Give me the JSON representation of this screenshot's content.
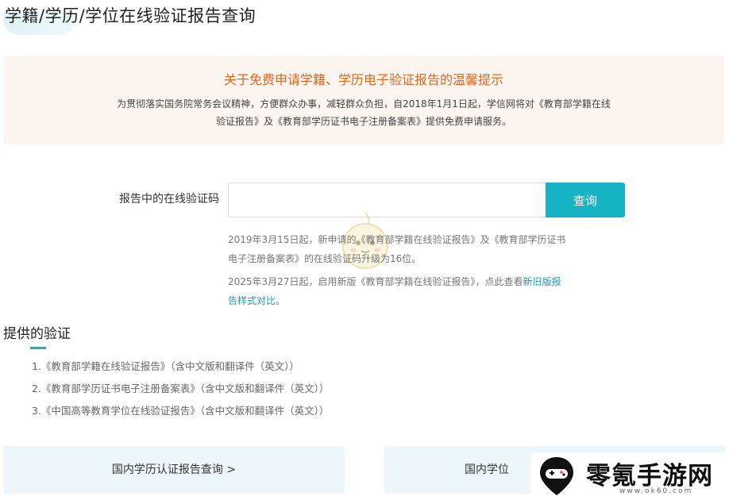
{
  "page": {
    "title": "学籍/学历/学位在线验证报告查询"
  },
  "notice": {
    "title": "关于免费申请学籍、学历电子验证报告的温馨提示",
    "line1": "为贯彻落实国务院常务会议精神，方便群众办事，减轻群众负担，自2018年1月1日起，学信网将对《教育部学籍在线",
    "line2": "验证报告》及《教育部学历证书电子注册备案表》提供免费申请服务。"
  },
  "verify": {
    "label": "报告中的在线验证码",
    "input_value": "",
    "button_label": "查询"
  },
  "hints": {
    "hint1_line1": "2019年3月15日起，新申请的《教育部学籍在线验证报告》及《教育部学历证书",
    "hint1_line2": "电子注册备案表》的在线验证码升级为16位。",
    "hint2_prefix": "2025年3月27日起，启用新版《教育部学籍在线验证报告》，点此查看",
    "hint2_link_line1": "新旧版报",
    "hint2_link_line2": "告样式对比",
    "hint2_suffix": "。"
  },
  "provided": {
    "title": "提供的验证",
    "items": [
      "1.《教育部学籍在线验证报告》（含中文版和翻译件（英文））",
      "2.《教育部学历证书电子注册备案表》（含中文版和翻译件（英文））",
      "3.《中国高等教育学位在线验证报告》（含中文版和翻译件（英文））"
    ]
  },
  "cards": {
    "left_label": "国内学历认证报告查询 >",
    "right_label": "国内学位"
  },
  "watermark": {
    "text": "零氪手游网",
    "url": "www.ok60.com"
  },
  "colors": {
    "accent": "#16b3c4",
    "notice_title": "#e0651e",
    "notice_bg": "#fdf6f0",
    "card_bg": "#edf6fb"
  }
}
